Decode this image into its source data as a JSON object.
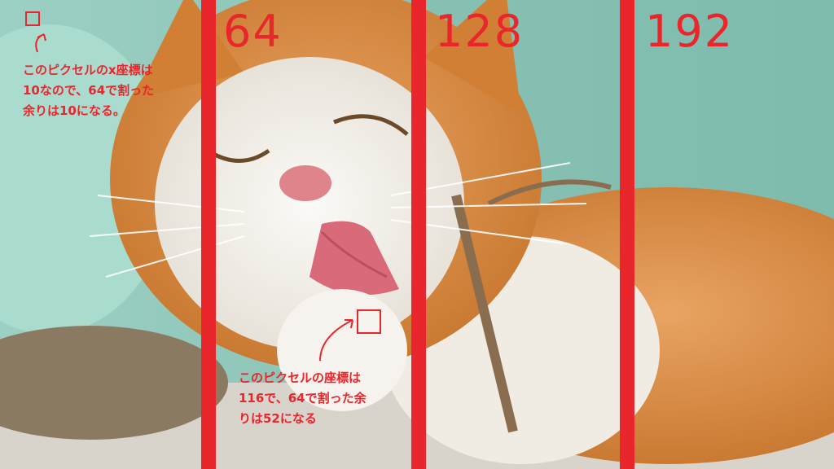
{
  "colors": {
    "annotation": "#e8262b",
    "background": "#8fc9bd",
    "fur_orange": "#d98a3c",
    "fur_white": "#f2efe9",
    "tongue": "#d86a7a"
  },
  "photo": {
    "subject_icon": "cat-photo"
  },
  "markers": [
    {
      "label": "64"
    },
    {
      "label": "128"
    },
    {
      "label": "192"
    }
  ],
  "notes": [
    {
      "lines": [
        "このピクセルのx座標は",
        "10なので、64で割った",
        "余りは10になる。"
      ]
    },
    {
      "lines": [
        "このピクセルの座標は",
        "116で、64で割った余",
        "りは52になる"
      ]
    }
  ]
}
